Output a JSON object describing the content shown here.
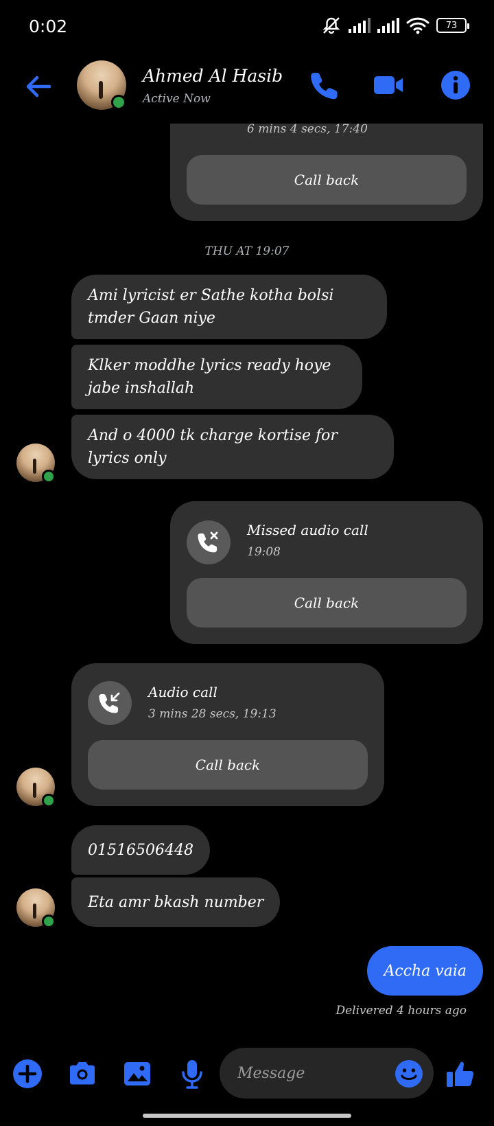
{
  "status_bar": {
    "time": "0:02",
    "battery": "73"
  },
  "header": {
    "contact_name": "Ahmed Al Hasib",
    "contact_status": "Active Now"
  },
  "messages": {
    "top_call": {
      "subtitle": "6 mins 4 secs, 17:40",
      "call_back": "Call back"
    },
    "timestamp": "THU AT 19:07",
    "text_1": "Ami lyricist er Sathe kotha bolsi tmder Gaan niye",
    "text_2": "Klker moddhe lyrics ready hoye jabe inshallah",
    "text_3": "And o 4000 tk charge kortise for lyrics only",
    "missed_call": {
      "title": "Missed audio call",
      "subtitle": "19:08",
      "call_back": "Call back"
    },
    "audio_call": {
      "title": "Audio call",
      "subtitle": "3 mins 28 secs, 19:13",
      "call_back": "Call back"
    },
    "text_4": "01516506448",
    "text_5": "Eta amr bkash number",
    "sent_1": "Accha vaia",
    "delivered": "Delivered 4 hours ago"
  },
  "composer": {
    "placeholder": "Message"
  },
  "colors": {
    "accent": "#2f6bf5",
    "bubble": "#303030",
    "online": "#31a24c"
  }
}
